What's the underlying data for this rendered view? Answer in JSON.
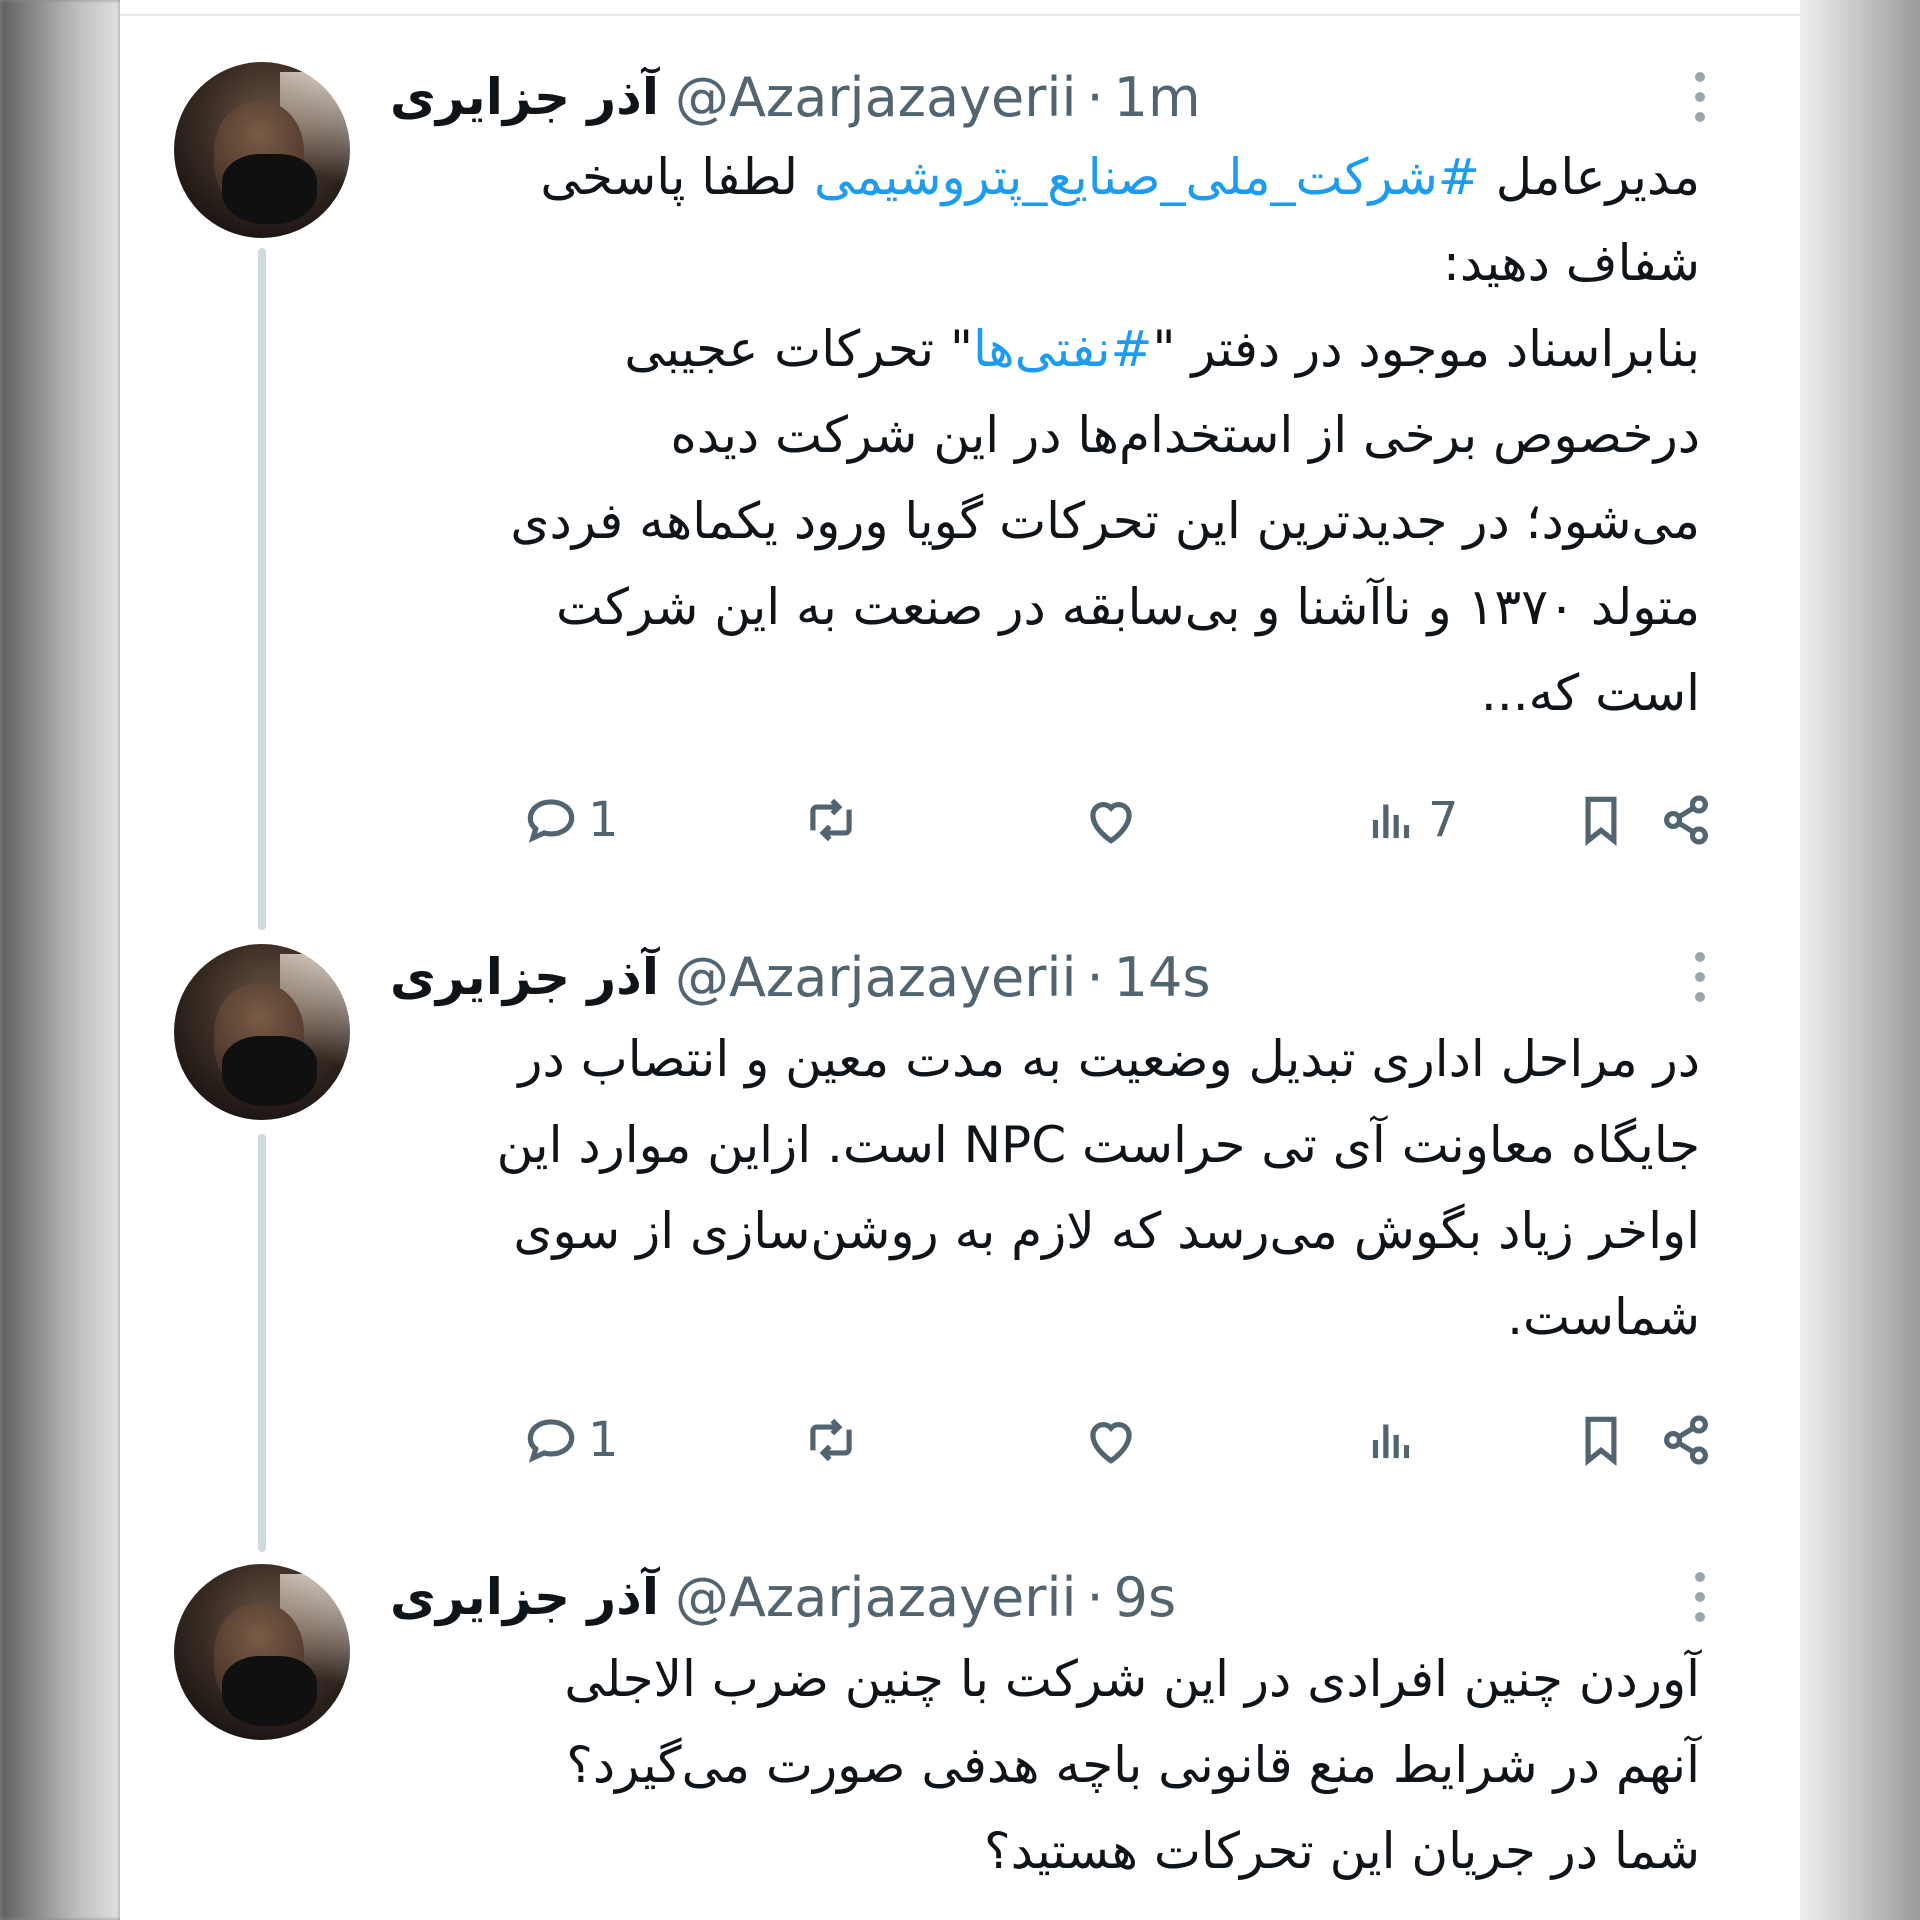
{
  "tweets": [
    {
      "name": "آذر جزایری",
      "handle": "@Azarjazayerii",
      "separator": "·",
      "time": "1m",
      "lines": [
        {
          "before": "مدیرعامل ",
          "hashtag": "#شرکت_ملی_صنایع_پتروشیمی",
          "after": " لطفا پاسخی"
        },
        {
          "text": "شفاف دهید:"
        },
        {
          "before": "بنابراسناد موجود در دفتر \"",
          "hashtag": "#نفتی‌ها",
          "after": "\" تحرکات عجیبی"
        },
        {
          "text": "درخصوص برخی از استخدام‌ها در این شرکت دیده"
        },
        {
          "text": "می‌شود؛ در جدیدترین این تحرکات گویا ورود یکماهه فردی"
        },
        {
          "text": "متولد ۱۳۷۰ و ناآشنا و بی‌سابقه در صنعت به این شرکت"
        },
        {
          "text": "است که..."
        }
      ],
      "actions": {
        "replies": "1",
        "retweets": "",
        "likes": "",
        "views": "7"
      }
    },
    {
      "name": "آذر جزایری",
      "handle": "@Azarjazayerii",
      "separator": "·",
      "time": "14s",
      "lines": [
        {
          "text": "در مراحل اداری تبدیل وضعیت به مدت معین و انتصاب در"
        },
        {
          "text": "جایگاه معاونت آی تی حراست NPC است. ازاین موارد این"
        },
        {
          "text": "اواخر زیاد بگوش می‌رسد که لازم به روشن‌سازی از سوی"
        },
        {
          "text": "شماست."
        }
      ],
      "actions": {
        "replies": "1",
        "retweets": "",
        "likes": "",
        "views": ""
      }
    },
    {
      "name": "آذر جزایری",
      "handle": "@Azarjazayerii",
      "separator": "·",
      "time": "9s",
      "lines": [
        {
          "text": "آوردن چنین افرادی در این شرکت با چنین ضرب الاجلی"
        },
        {
          "text": "آنهم در شرایط منع قانونی باچه هدفی صورت می‌گیرد؟"
        },
        {
          "text": "شما در جریان این تحرکات هستید؟"
        }
      ]
    }
  ]
}
